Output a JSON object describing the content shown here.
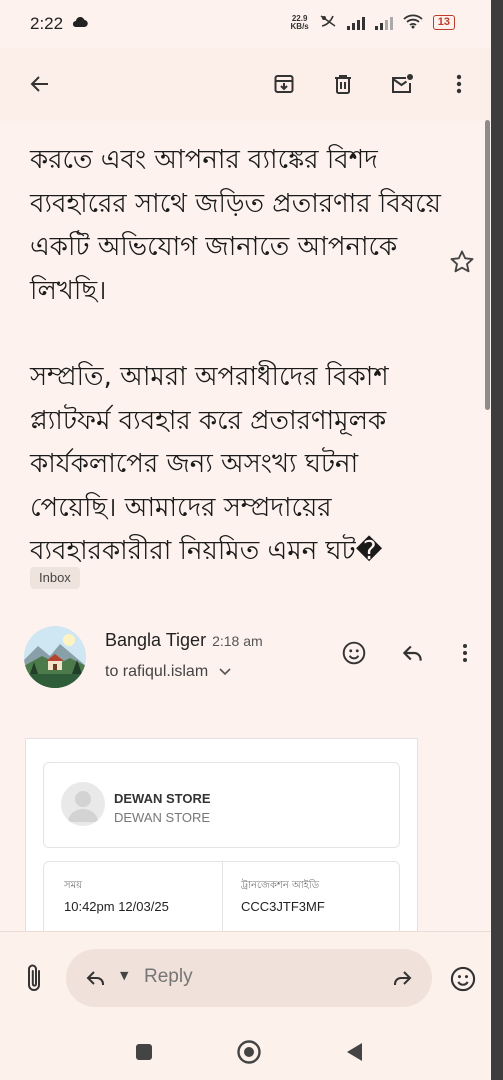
{
  "status_bar": {
    "time": "2:22",
    "net_speed_value": "22.9",
    "net_speed_unit": "KB/s",
    "battery": "13"
  },
  "app_bar": {
    "icons": [
      "back-arrow-icon",
      "archive-icon",
      "delete-icon",
      "mark-unread-icon",
      "more-vert-icon"
    ]
  },
  "email": {
    "body_paragraphs": [
      "করতে এবং আপনার ব্যাঙ্কের বিশদ ব্যবহারের সাথে জড়িত প্রতারণার বিষয়ে একটি অভিযোগ জানাতে আপনাকে লিখছি।",
      "সম্প্রতি, আমরা অপরাধীদের বিকাশ প্ল্যাটফর্ম ব্যবহার করে প্রতারণামূলক কার্যকলাপের জন্য অসংখ্য ঘটনা পেয়েছি। আমাদের সম্প্রদায়ের ব্যবহারকারীরা নিয়মিত এমন ঘট�"
    ],
    "label": "Inbox"
  },
  "message": {
    "sender": "Bangla Tiger",
    "time": "2:18 am",
    "recipient": "to rafiqul.islam"
  },
  "receipt": {
    "store_name": "DEWAN STORE",
    "store_sub": "DEWAN STORE",
    "time_label": "সময়",
    "time_value": "10:42pm 12/03/25",
    "trx_label": "ট্রানজেকশন আইডি",
    "trx_value": "CCC3JTF3MF"
  },
  "reply_bar": {
    "placeholder": "Reply"
  },
  "colors": {
    "background": "#fdf2ee",
    "reply_box": "#f0e1db",
    "battery_low": "#c0392b"
  }
}
